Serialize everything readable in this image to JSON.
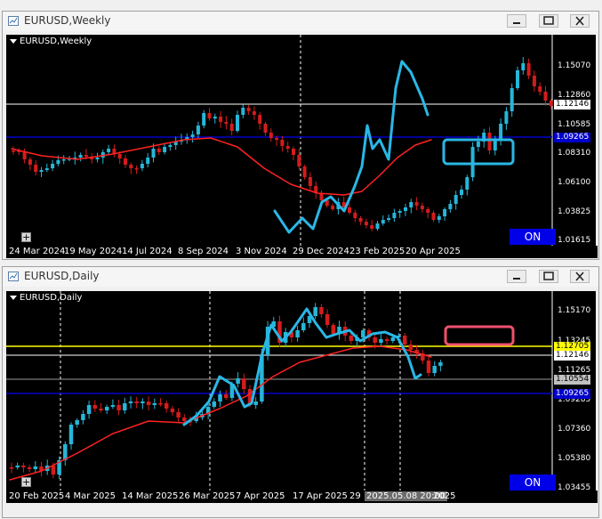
{
  "colors": {
    "bull": "#26b6d9",
    "bear": "#d41c1c",
    "ma": "#ff2222",
    "blue_line": "#0000cc",
    "yellow_line": "#ffff00",
    "white_line": "#ffffff",
    "drawing_blue": "#2ab7e6",
    "box_blue": "#2ab7e6",
    "box_pink": "#f0506e",
    "on_button": "#0000e6"
  },
  "weekly": {
    "window_title": "EURUSD,Weekly",
    "symbol_label": "EURUSD,Weekly",
    "x_labels": [
      "24 Mar 2024",
      "19 May 2024",
      "14 Jul 2024",
      "8 Sep 2024",
      "3 Nov 2024",
      "29 Dec 2024",
      "23 Feb 2025",
      "20 Apr 2025"
    ],
    "y_labels": [
      "1.15070",
      "1.12860",
      "1.10585",
      "1.08310",
      "1.06100",
      "1.03825",
      "1.01615"
    ],
    "price_tags": {
      "current": "1.12146",
      "blue_level": "1.09265"
    },
    "on_button": "ON",
    "plus_icon": "+"
  },
  "daily": {
    "window_title": "EURUSD,Daily",
    "symbol_label": "EURUSD,Daily",
    "x_labels": [
      "20 Feb 2025",
      "4 Mar 2025",
      "14 Mar 2025",
      "26 Mar 2025",
      "7 Apr 2025",
      "17 Apr 2025",
      "29",
      "2025.05.08 20:00",
      "2025"
    ],
    "y_labels": [
      "1.15170",
      "1.13245",
      "1.11265",
      "1.09285",
      "1.07360",
      "1.05380",
      "1.03455"
    ],
    "price_tags": {
      "yellow_level": "1.12705",
      "current": "1.12146",
      "gray_level": "1.10554",
      "blue_level": "1.09265"
    },
    "on_button": "ON",
    "plus_icon": "+"
  }
}
